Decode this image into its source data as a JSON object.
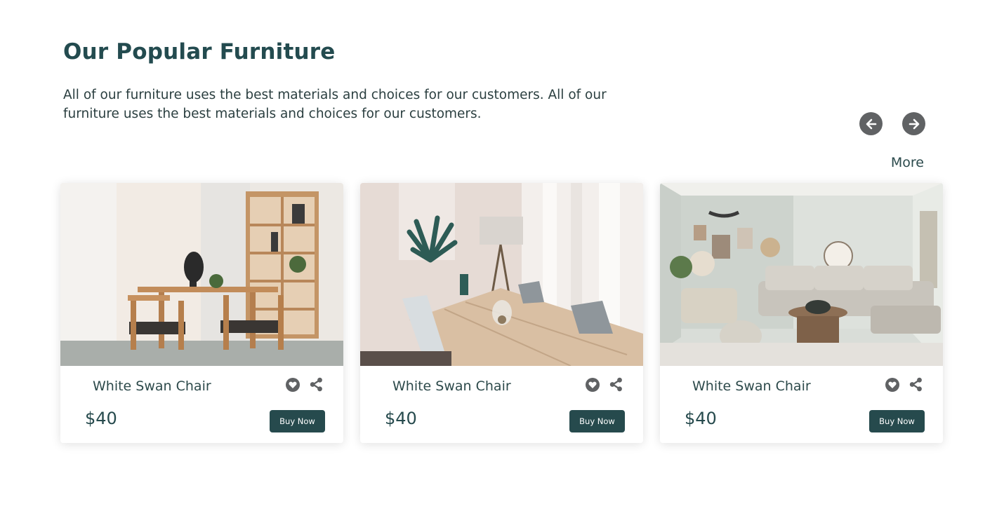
{
  "section": {
    "title": "Our Popular Furniture",
    "description": "All of our furniture uses the best materials and choices for our customers. All of our furniture uses the best materials and choices for our customers.",
    "more_label": "More"
  },
  "carousel": {
    "prev_icon": "arrow-left-icon",
    "next_icon": "arrow-right-icon"
  },
  "products": [
    {
      "name": "White Swan Chair",
      "price": "$40",
      "buy_label": "Buy Now",
      "image": "dining-room-wooden-chairs"
    },
    {
      "name": "White Swan Chair",
      "price": "$40",
      "buy_label": "Buy Now",
      "image": "dining-table-with-lamp"
    },
    {
      "name": "White Swan Chair",
      "price": "$40",
      "buy_label": "Buy Now",
      "image": "living-room-sofa"
    }
  ],
  "colors": {
    "brand": "#264a4d",
    "icon_gray": "#606264"
  }
}
